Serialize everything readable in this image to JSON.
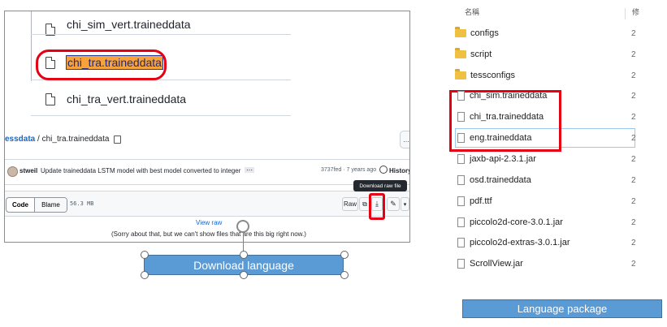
{
  "github": {
    "files": [
      {
        "name": "chi_sim_vert.traineddata"
      },
      {
        "name": "chi_tra.traineddata"
      },
      {
        "name": "chi_tra_vert.traineddata"
      }
    ],
    "breadcrumb_parent": "essdata",
    "breadcrumb_sep": " / ",
    "breadcrumb_file": "chi_tra.traineddata",
    "commit_author": "stweil",
    "commit_message": "Update traineddata LSTM model with best model converted to integer",
    "commit_hash_age": "3737fed · 7 years ago",
    "history_label": "History",
    "tab_code": "Code",
    "tab_blame": "Blame",
    "file_size": "56.3 MB",
    "raw_label": "Raw",
    "tooltip": "Download raw file",
    "view_raw": "View raw",
    "sorry": "(Sorry about that, but we can't show files that are this big right now.)"
  },
  "callout_left": "Download language",
  "explorer": {
    "header": "名稱",
    "header_right": "修",
    "items": [
      {
        "name": "configs",
        "kind": "folder",
        "num": "2"
      },
      {
        "name": "script",
        "kind": "folder",
        "num": "2"
      },
      {
        "name": "tessconfigs",
        "kind": "folder",
        "num": "2"
      },
      {
        "name": "chi_sim.traineddata",
        "kind": "file",
        "num": "2"
      },
      {
        "name": "chi_tra.traineddata",
        "kind": "file",
        "num": "2"
      },
      {
        "name": "eng.traineddata",
        "kind": "file",
        "num": "2"
      },
      {
        "name": "jaxb-api-2.3.1.jar",
        "kind": "file",
        "num": "2"
      },
      {
        "name": "osd.traineddata",
        "kind": "file",
        "num": "2"
      },
      {
        "name": "pdf.ttf",
        "kind": "file",
        "num": "2"
      },
      {
        "name": "piccolo2d-core-3.0.1.jar",
        "kind": "file",
        "num": "2"
      },
      {
        "name": "piccolo2d-extras-3.0.1.jar",
        "kind": "file",
        "num": "2"
      },
      {
        "name": "ScrollView.jar",
        "kind": "file",
        "num": "2"
      }
    ]
  },
  "callout_right": "Language package",
  "colors": {
    "highlight_red": "#e50012",
    "callout_blue": "#5b9bd5"
  }
}
